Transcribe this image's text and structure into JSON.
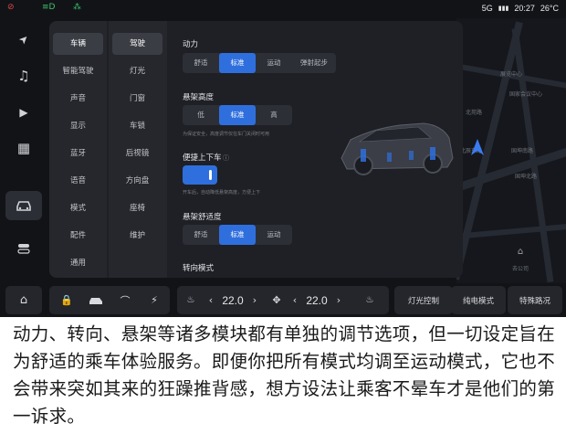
{
  "status_bar": {
    "left_icons": [
      "hazard-icon",
      "light-icon",
      "beam-icon"
    ],
    "signal": "5G",
    "time": "20:27",
    "temperature": "26°C",
    "colors": {
      "hazard": "#e04848",
      "light": "#3ec46d",
      "beam": "#3ec46d"
    }
  },
  "rail": {
    "items": [
      {
        "icon": "navigation-icon",
        "glyph": "➤"
      },
      {
        "icon": "music-icon",
        "glyph": "♫"
      },
      {
        "icon": "video-icon",
        "glyph": "▶"
      },
      {
        "icon": "apps-icon",
        "glyph": "▦"
      },
      {
        "icon": "car-icon",
        "glyph": "🚘",
        "active": true
      },
      {
        "icon": "toggle-icon",
        "glyph": "⚙"
      }
    ]
  },
  "settings": {
    "category_tabs": [
      "车辆",
      "智能驾驶",
      "声音",
      "显示",
      "蓝牙",
      "语音",
      "模式",
      "配件",
      "通用"
    ],
    "category_active": "车辆",
    "subcategory_tabs": [
      "驾驶",
      "灯光",
      "门窗",
      "车锁",
      "后视镜",
      "方向盘",
      "座椅",
      "维护"
    ],
    "subcategory_active": "驾驶",
    "power": {
      "title": "动力",
      "options": [
        "舒适",
        "标准",
        "运动",
        "弹射起步"
      ],
      "selected": "标准"
    },
    "suspension_height": {
      "title": "悬架高度",
      "options": [
        "低",
        "标准",
        "高"
      ],
      "selected": "标准",
      "hint": "为保证安全，高度调节仅在车门关闭时可用"
    },
    "easy_entry": {
      "title": "便捷上下车",
      "enabled": true,
      "hint": "开车后，自动降低悬架高度，方便上下"
    },
    "suspension_comfort": {
      "title": "悬架舒适度",
      "options": [
        "舒适",
        "标准",
        "运动"
      ],
      "selected": "标准"
    },
    "steering_mode": {
      "title": "转向模式"
    }
  },
  "map": {
    "labels": [
      "国家会议中心",
      "展览中心",
      "北辰东路",
      "北苑路",
      "国坤南路",
      "国坤北路"
    ],
    "poi_label": "去公司",
    "accent": "#3a7cf0"
  },
  "dock": {
    "home_icon": "home-icon",
    "lock_icon": "lock-icon",
    "car_icon": "car-icon",
    "wiper_icon": "wiper-icon",
    "charge_icon": "charge-icon",
    "left_seat_icon": "seat-heat-icon",
    "left_fan_icon": "fan-icon",
    "right_fan_icon": "fan-icon",
    "right_seat_icon": "seat-heat-icon",
    "left_temp": "22.0",
    "right_temp": "22.0",
    "chevron_left": "‹",
    "chevron_right": "›",
    "buttons": [
      "灯光控制",
      "纯电模式",
      "特殊路况"
    ]
  },
  "caption": "动力、转向、悬架等诸多模块都有单独的调节选项，但一切设定旨在为舒适的乘车体验服务。即便你把所有模式均调至运动模式，它也不会带来突如其来的狂躁推背感，想方设法让乘客不晕车才是他们的第一诉求。"
}
